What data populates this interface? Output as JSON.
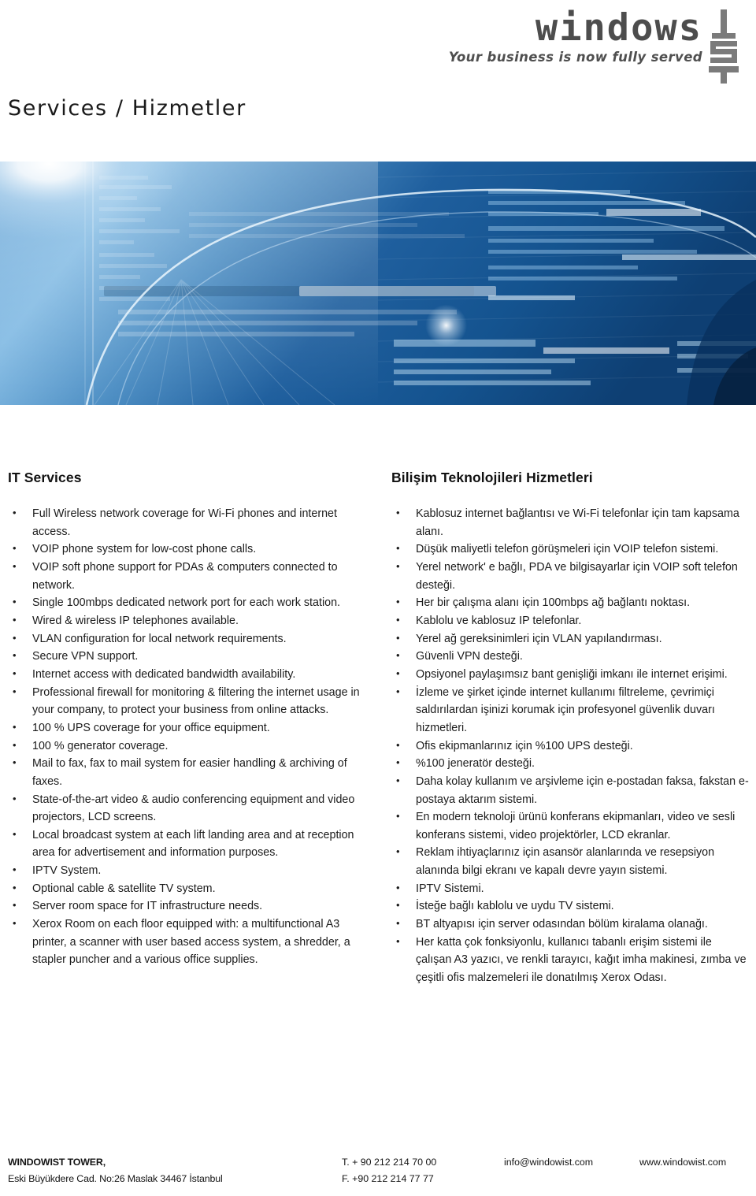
{
  "header": {
    "logo_word": "windows",
    "logo_tagline": "Your business is now fully served",
    "logo_mark": "ist-monogram"
  },
  "page_title": "Services / Hizmetler",
  "hero": {
    "alt": "abstract blue technology banner with screen text and light flare"
  },
  "columns": {
    "english": {
      "heading": "IT Services",
      "items": [
        "Full Wireless network coverage for Wi-Fi phones and internet access.",
        "VOIP phone system for low-cost phone calls.",
        "VOIP soft phone support for PDAs & computers connected to network.",
        "Single 100mbps dedicated network port for each work station.",
        "Wired & wireless IP telephones available.",
        "VLAN configuration for local network requirements.",
        "Secure VPN support.",
        "Internet access with dedicated bandwidth availability.",
        "Professional firewall for monitoring & filtering the internet usage in your company, to protect your business from online attacks.",
        "100 % UPS coverage for your office equipment.",
        "100 % generator coverage.",
        "Mail to fax, fax to mail system for easier handling & archiving of faxes.",
        "State-of-the-art video & audio conferencing equipment and video projectors, LCD screens.",
        "Local broadcast system at each lift landing area and at reception area for advertisement and information purposes.",
        "IPTV System.",
        "Optional cable & satellite TV system.",
        "Server room space for IT infrastructure needs.",
        "Xerox Room on each floor equipped with: a multifunctional A3 printer, a scanner with user based access system, a shredder, a stapler puncher and a various office supplies."
      ]
    },
    "turkish": {
      "heading": "Bilişim Teknolojileri Hizmetleri",
      "items": [
        "Kablosuz internet bağlantısı ve Wi-Fi telefonlar için tam kapsama alanı.",
        "Düşük maliyetli telefon görüşmeleri için VOIP telefon sistemi.",
        "Yerel network' e bağlı, PDA ve bilgisayarlar için VOIP soft telefon desteği.",
        "Her bir çalışma alanı için 100mbps ağ bağlantı noktası.",
        "Kablolu ve kablosuz IP telefonlar.",
        "Yerel ağ gereksinimleri için VLAN yapılandırması.",
        "Güvenli VPN desteği.",
        "Opsiyonel paylaşımsız bant genişliği imkanı ile internet erişimi.",
        "İzleme ve şirket içinde internet kullanımı filtreleme, çevrimiçi saldırılardan işinizi korumak için profesyonel güvenlik duvarı hizmetleri.",
        "Ofis ekipmanlarınız için %100 UPS desteği.",
        "%100 jeneratör desteği.",
        "Daha kolay kullanım ve arşivleme için e-postadan faksa, fakstan e-postaya aktarım sistemi.",
        "En modern teknoloji ürünü konferans ekipmanları, video ve sesli konferans sistemi, video projektörler, LCD ekranlar.",
        "Reklam ihtiyaçlarınız için asansör alanlarında  ve resepsiyon alanında bilgi ekranı ve kapalı devre yayın sistemi.",
        "IPTV Sistemi.",
        "İsteğe bağlı kablolu ve uydu TV sistemi.",
        "BT altyapısı için server odasından bölüm kiralama olanağı.",
        "Her katta çok fonksiyonlu, kullanıcı tabanlı erişim sistemi ile çalışan A3 yazıcı, ve renkli tarayıcı, kağıt imha makinesi, zımba ve çeşitli ofis malzemeleri ile donatılmış Xerox Odası."
      ]
    }
  },
  "footer": {
    "company": "WINDOWIST TOWER,",
    "address": "Eski Büyükdere Cad. No:26 Maslak 34467 İstanbul",
    "tel": "T. + 90 212 214 70 00",
    "fax": "F.  +90 212 214 77 77",
    "email": "info@windowist.com",
    "website": "www.windowist.com"
  },
  "colors": {
    "hero_blue_dark": "#14538f",
    "hero_blue_mid": "#3f86c6",
    "hero_blue_light": "#9fc9e8",
    "logo_gray": "#4d4d4d",
    "mark_gray": "#7b7b7b",
    "text": "#1b1b1b"
  }
}
